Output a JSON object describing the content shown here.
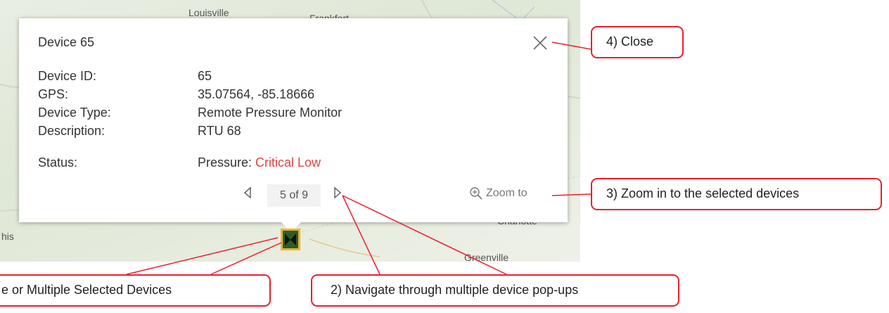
{
  "map": {
    "labels": [
      "Louisville",
      "Frankfort",
      "his",
      "Charlotte",
      "Greenville"
    ]
  },
  "popup": {
    "title": "Device 65",
    "fields": [
      {
        "label": "Device ID:",
        "value": "65"
      },
      {
        "label": "GPS:",
        "value": "35.07564, -85.18666"
      },
      {
        "label": "Device Type:",
        "value": "Remote Pressure Monitor"
      },
      {
        "label": "Description:",
        "value": "RTU 68"
      },
      {
        "label": "Status:",
        "value_prefix": "Pressure: ",
        "value_highlight": "Critical Low"
      }
    ],
    "pagination": "5 of 9",
    "zoom_label": "Zoom to",
    "critical_color": "#e0443f"
  },
  "callouts": {
    "close": "4) Close",
    "zoom": "3) Zoom in to the selected devices",
    "navigate": "2) Navigate through multiple device pop-ups",
    "selected": "e or Multiple Selected Devices"
  },
  "icons": [
    "close-icon",
    "chevron-left-icon",
    "chevron-right-icon",
    "zoom-in-icon",
    "device-marker-icon"
  ],
  "accent_color": "#e8202f"
}
